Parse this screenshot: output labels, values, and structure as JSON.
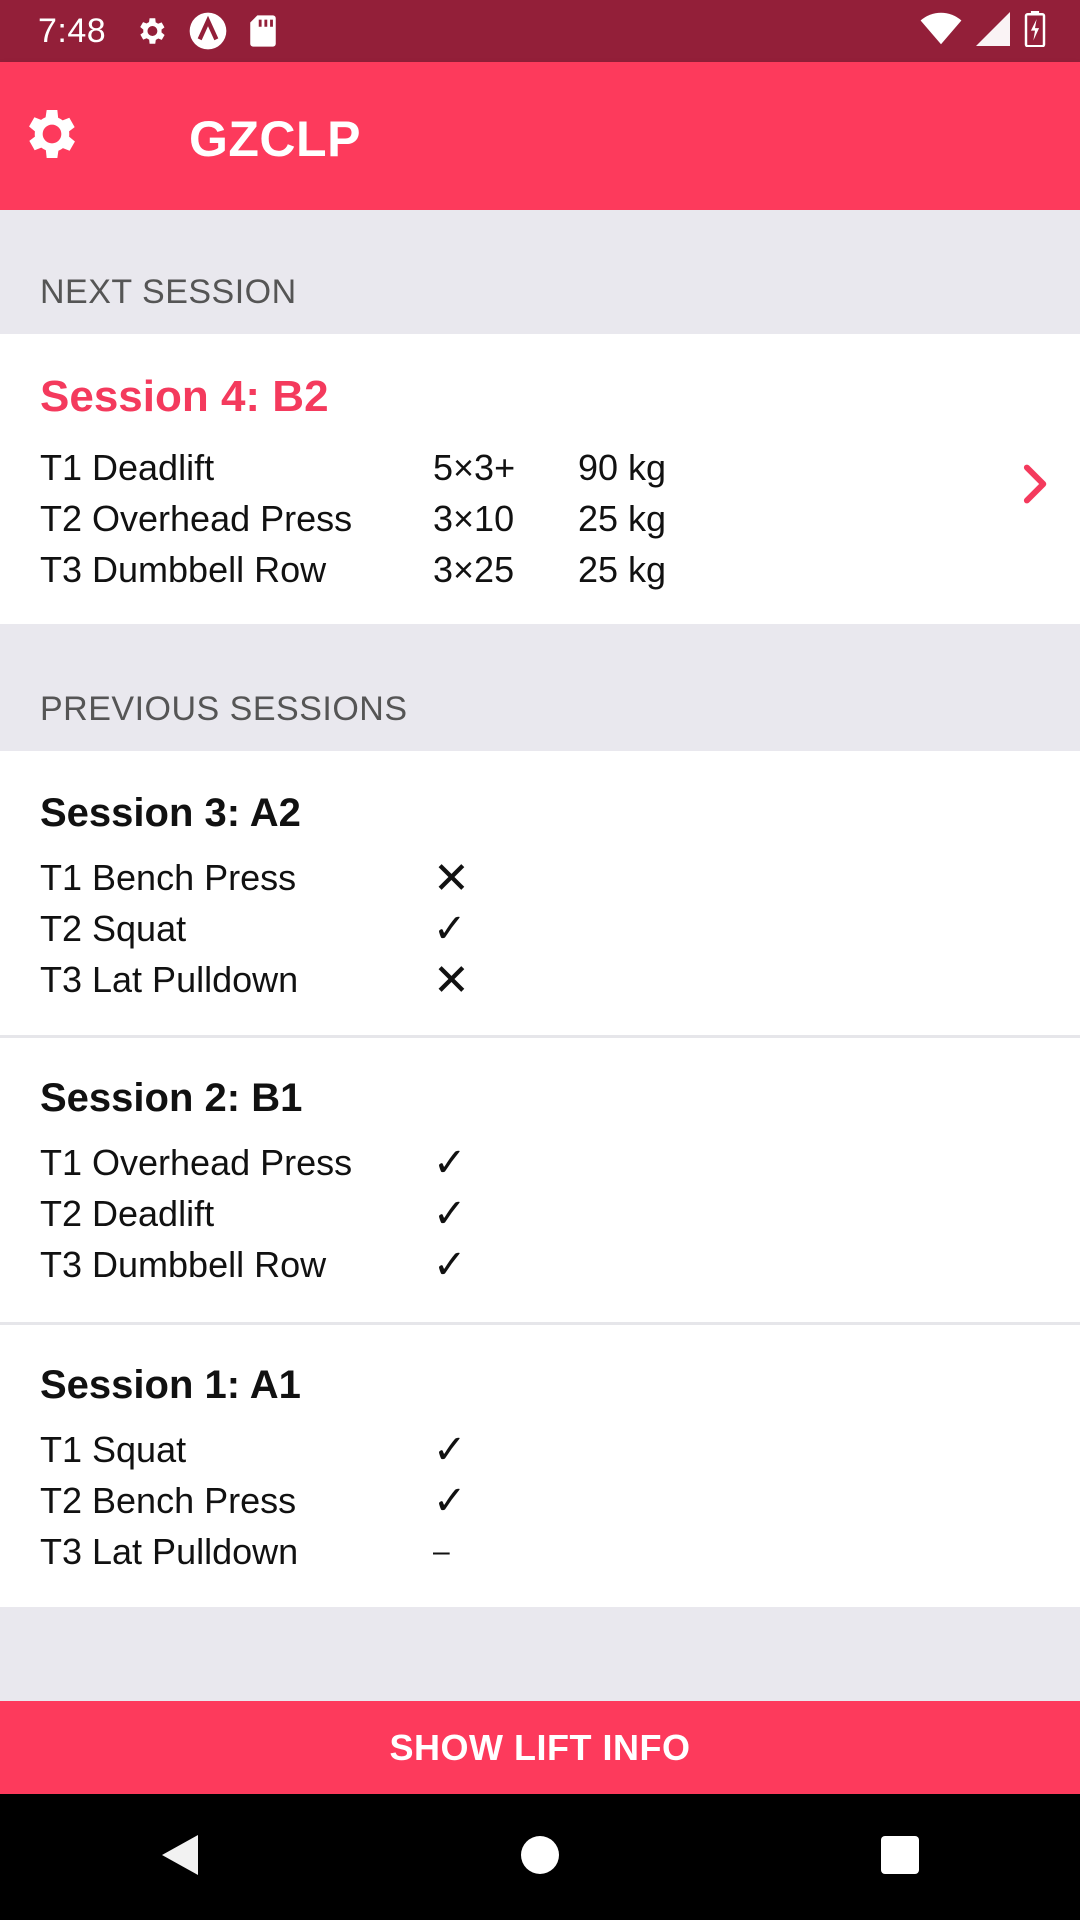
{
  "status_bar": {
    "time": "7:48"
  },
  "app_bar": {
    "title": "GZCLP"
  },
  "next_session": {
    "header": "NEXT SESSION",
    "title": "Session 4: B2",
    "lifts": [
      {
        "name": "T1 Deadlift",
        "scheme": "5×3+",
        "weight": "90 kg"
      },
      {
        "name": "T2 Overhead Press",
        "scheme": "3×10",
        "weight": "25 kg"
      },
      {
        "name": "T3 Dumbbell Row",
        "scheme": "3×25",
        "weight": "25 kg"
      }
    ]
  },
  "previous_sessions": {
    "header": "PREVIOUS SESSIONS",
    "sessions": [
      {
        "title": "Session 3: A2",
        "lifts": [
          {
            "name": "T1 Bench Press",
            "result": "✕"
          },
          {
            "name": "T2 Squat",
            "result": "✓"
          },
          {
            "name": "T3 Lat Pulldown",
            "result": "✕"
          }
        ]
      },
      {
        "title": "Session 2: B1",
        "lifts": [
          {
            "name": "T1 Overhead Press",
            "result": "✓"
          },
          {
            "name": "T2 Deadlift",
            "result": "✓"
          },
          {
            "name": "T3 Dumbbell Row",
            "result": "✓"
          }
        ]
      },
      {
        "title": "Session 1: A1",
        "lifts": [
          {
            "name": "T1 Squat",
            "result": "✓"
          },
          {
            "name": "T2 Bench Press",
            "result": "✓"
          },
          {
            "name": "T3 Lat Pulldown",
            "result": "–"
          }
        ]
      }
    ]
  },
  "footer": {
    "show_lift_info": "SHOW LIFT INFO"
  },
  "colors": {
    "status_bar": "#931f39",
    "app_bar": "#fd3a5c",
    "accent_text": "#f43a5d",
    "background": "#e9e8ee"
  },
  "icons": {
    "status": [
      "gear-icon",
      "a-circle-icon",
      "sd-card-icon",
      "wifi-icon",
      "signal-icon",
      "battery-icon"
    ],
    "app_bar": "gear-icon",
    "next_session": "chevron-right-icon",
    "nav": [
      "back-icon",
      "home-icon",
      "recents-icon"
    ]
  }
}
